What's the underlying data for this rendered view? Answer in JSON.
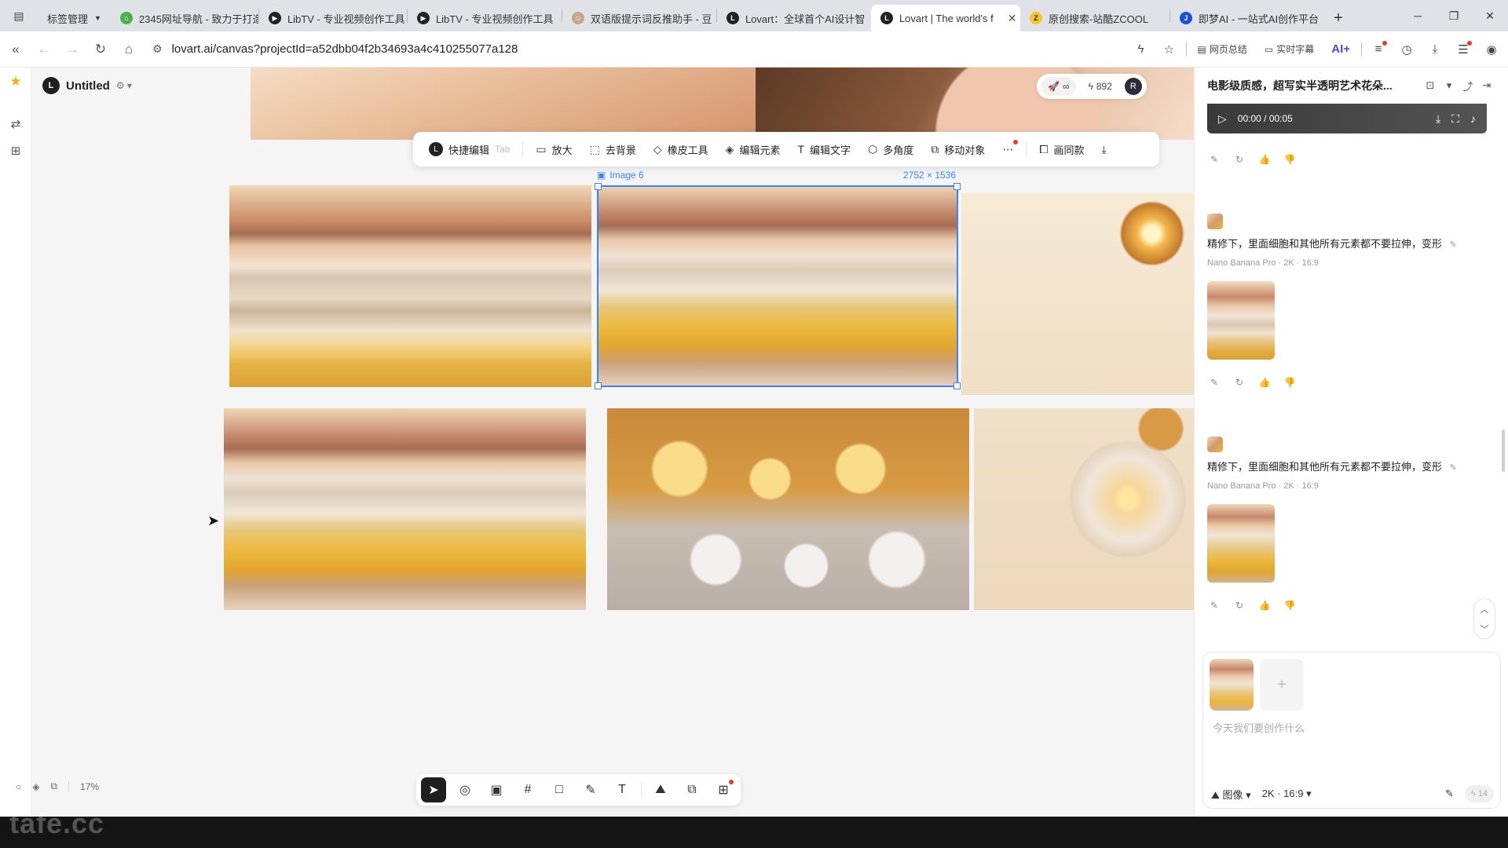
{
  "browser": {
    "tab_group_label": "标签管理",
    "tabs": [
      {
        "title": "2345网址导航 - 致力于打造",
        "icon": "home-icon"
      },
      {
        "title": "LibTV - 专业视频创作工具",
        "icon": "libtv-icon"
      },
      {
        "title": "LibTV - 专业视频创作工具",
        "icon": "libtv-icon"
      },
      {
        "title": "双语版提示词反推助手 - 豆",
        "icon": "face-icon"
      },
      {
        "title": "Lovart：全球首个AI设计智",
        "icon": "lovart-icon"
      },
      {
        "title": "Lovart | The world's f",
        "icon": "lovart-icon",
        "active": true
      },
      {
        "title": "原创搜索-站酷ZCOOL",
        "icon": "zcool-icon"
      },
      {
        "title": "即梦AI - 一站式AI创作平台",
        "icon": "jimeng-icon"
      }
    ],
    "url": "lovart.ai/canvas?projectId=a52dbb04f2b34693a4c410255077a128",
    "addr_actions": {
      "summary": "网页总结",
      "subtitles": "实时字幕",
      "ai": "AI+"
    }
  },
  "app": {
    "project_title": "Untitled",
    "top_pill": {
      "credits": "892",
      "avatar": "R",
      "infinite": "∞"
    },
    "selection": {
      "label": "Image 6",
      "dims": "2752 × 1536"
    },
    "image_toolbar": [
      {
        "label": "快捷编辑",
        "hint": "Tab",
        "icon": "lovart-logo-icon"
      },
      {
        "label": "放大",
        "icon": "hd-icon"
      },
      {
        "label": "去背景",
        "icon": "remove-bg-icon"
      },
      {
        "label": "橡皮工具",
        "icon": "eraser-icon"
      },
      {
        "label": "编辑元素",
        "icon": "layers-icon"
      },
      {
        "label": "编辑文字",
        "icon": "edit-text-icon"
      },
      {
        "label": "多角度",
        "icon": "cube-icon"
      },
      {
        "label": "移动对象",
        "icon": "move-object-icon"
      },
      {
        "label": "画同款",
        "icon": "same-style-icon"
      }
    ],
    "zoom": "17%"
  },
  "panel": {
    "title": "电影级质感，超写实半透明艺术花朵...",
    "video": {
      "time": "00:00 / 00:05"
    },
    "messages": [
      {
        "text": "精修下，里面细胞和其他所有元素都不要拉伸，变形",
        "meta": "Nano Banana Pro · 2K · 16:9"
      },
      {
        "text": "精修下，里面细胞和其他所有元素都不要拉伸，变形",
        "meta": "Nano Banana Pro · 2K · 16:9"
      }
    ],
    "composer": {
      "placeholder": "今天我们要创作什么",
      "mode": "图像",
      "ratio": "2K · 16:9",
      "credits": "14"
    }
  },
  "watermark": "tafe.cc"
}
